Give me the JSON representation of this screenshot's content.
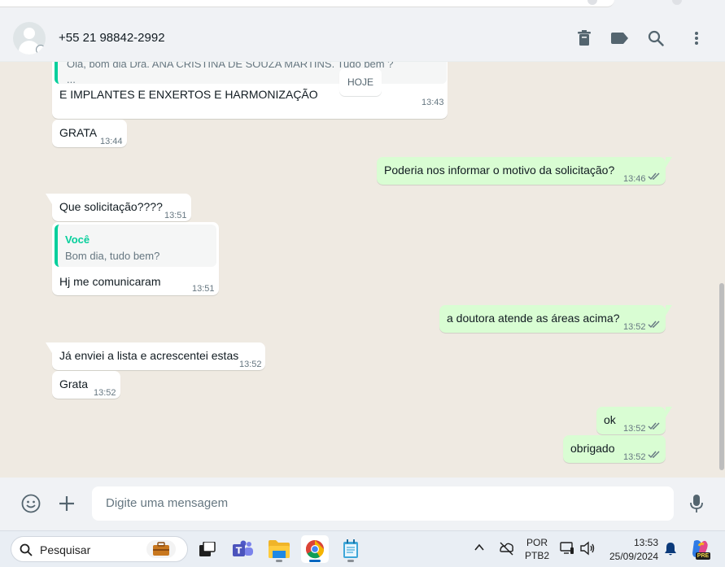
{
  "header": {
    "contact_name": "+55 21 98842-2992",
    "icons": [
      "avatar-default-icon",
      "delete-icon",
      "label-icon",
      "search-icon",
      "menu-icon"
    ]
  },
  "chat": {
    "partial_top": {
      "preview_line": "Olá, bom dia Dra. ANA CRISTINA DE SOUZA MARTINS. Tudo bem ?",
      "preview_ellipsis": "...",
      "date_chip": "HOJE"
    },
    "messages": [
      {
        "dir": "in",
        "text": "E IMPLANTES E ENXERTOS E HARMONIZAÇÃO",
        "time": "13:43"
      },
      {
        "dir": "in",
        "text": "GRATA",
        "time": "13:44"
      },
      {
        "dir": "out",
        "text": "Poderia nos informar o motivo da solicitação?",
        "time": "13:46"
      },
      {
        "dir": "in",
        "text": "Que solicitação????",
        "time": "13:51"
      },
      {
        "dir": "in",
        "quote_author": "Você",
        "quote_text": "Bom dia, tudo bem?",
        "text": "Hj me comunicaram",
        "time": "13:51"
      },
      {
        "dir": "out",
        "text": "a doutora atende as áreas acima?",
        "time": "13:52"
      },
      {
        "dir": "in",
        "text": "Já enviei a lista e acrescentei estas",
        "time": "13:52"
      },
      {
        "dir": "in",
        "text": "Grata",
        "time": "13:52"
      },
      {
        "dir": "out",
        "text": "ok",
        "time": "13:52"
      },
      {
        "dir": "out",
        "text": "obrigado",
        "time": "13:52"
      }
    ]
  },
  "composer": {
    "placeholder": "Digite uma mensagem"
  },
  "taskbar": {
    "search_label": "Pesquisar",
    "lang_top": "POR",
    "lang_bottom": "PTB2",
    "clock_time": "13:53",
    "clock_date": "25/09/2024",
    "copilot_badge": "PRE"
  },
  "colors": {
    "incoming_bubble": "#ffffff",
    "outgoing_bubble": "#d9fdd3",
    "chat_background": "#efeae2",
    "quote_accent": "#06cf9c",
    "read_ticks": "#667781"
  }
}
